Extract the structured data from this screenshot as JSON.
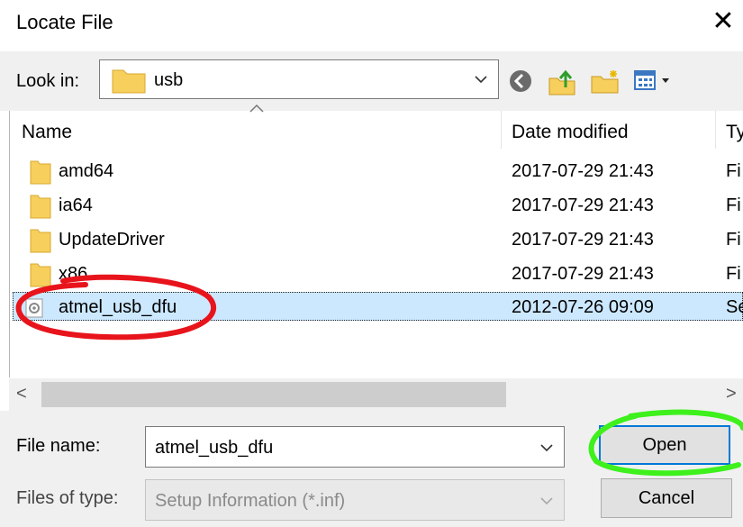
{
  "dialog": {
    "title": "Locate File",
    "close_glyph": "✕"
  },
  "toolbar": {
    "look_in_label": "Look in:",
    "look_in_value": "usb",
    "icons": [
      "back-icon",
      "up-folder-icon",
      "new-folder-icon",
      "view-menu-icon"
    ]
  },
  "columns": {
    "name": "Name",
    "date": "Date modified",
    "type": "Ty"
  },
  "files": [
    {
      "name": "amd64",
      "date": "2017-07-29 21:43",
      "type": "Fi",
      "icon": "folder-icon"
    },
    {
      "name": "ia64",
      "date": "2017-07-29 21:43",
      "type": "Fi",
      "icon": "folder-icon"
    },
    {
      "name": "UpdateDriver",
      "date": "2017-07-29 21:43",
      "type": "Fi",
      "icon": "folder-icon"
    },
    {
      "name": "x86",
      "date": "2017-07-29 21:43",
      "type": "Fi",
      "icon": "folder-icon"
    },
    {
      "name": "atmel_usb_dfu",
      "date": "2012-07-26 09:09",
      "type": "Se",
      "icon": "setup-file-icon",
      "selected": true
    }
  ],
  "scroll": {
    "left_glyph": "<",
    "right_glyph": ">"
  },
  "footer": {
    "file_name_label": "File name:",
    "file_name_value": "atmel_usb_dfu",
    "files_of_type_label": "Files of type:",
    "files_of_type_value": "Setup Information (*.inf)",
    "open_label": "Open",
    "cancel_label": "Cancel"
  },
  "colors": {
    "selection": "#cce8ff",
    "annotation_red": "#e8141c",
    "annotation_green": "#3ef01c",
    "folder": "#f6cf5c"
  }
}
